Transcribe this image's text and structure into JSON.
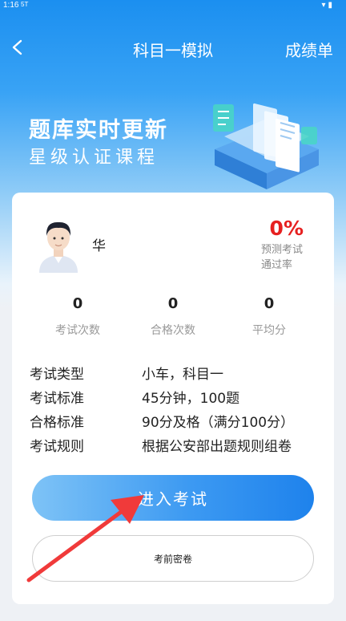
{
  "status_bar": {
    "time": "1:16",
    "network": "5T"
  },
  "header": {
    "title": "科目一模拟",
    "right_action": "成绩单"
  },
  "promo": {
    "title": "题库实时更新",
    "subtitle": "星级认证课程"
  },
  "profile": {
    "name": "华",
    "pass_rate": "0%",
    "pass_rate_label": "预测考试通过率"
  },
  "stats": [
    {
      "value": "0",
      "label": "考试次数"
    },
    {
      "value": "0",
      "label": "合格次数"
    },
    {
      "value": "0",
      "label": "平均分"
    }
  ],
  "exam_info": [
    {
      "key": "考试类型",
      "value": "小车，科目一"
    },
    {
      "key": "考试标准",
      "value": "45分钟，100题"
    },
    {
      "key": "合格标准",
      "value": "90分及格（满分100分）"
    },
    {
      "key": "考试规则",
      "value": "根据公安部出题规则组卷"
    }
  ],
  "buttons": {
    "start_exam": "进入考试",
    "pre_exam_paper": "考前密卷"
  },
  "colors": {
    "primary_blue": "#1e82ec",
    "pass_rate_red": "#e62020",
    "annotation_arrow": "#f03a3a"
  }
}
